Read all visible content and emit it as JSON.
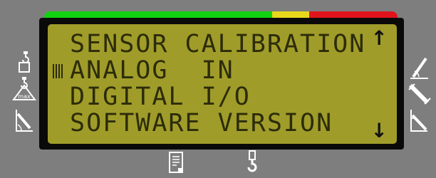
{
  "display": {
    "menu_items": [
      "SENSOR CALIBRATION",
      "ANALOG  IN",
      "DIGITAL I/O",
      "SOFTWARE VERSION"
    ],
    "selected_index": 1,
    "scroll_up_arrow": "↑",
    "scroll_down_arrow": "↓"
  },
  "left_icons": {
    "load_icon": "hook-load-icon",
    "max_load_icon": "max-load-icon",
    "max_load_label": "max",
    "boom_angle_icon": "boom-angle-icon"
  },
  "right_icons": {
    "boom_lower_icon": "boom-lower-icon",
    "boom_telescope_icon": "boom-telescope-icon",
    "boom_raise_icon": "boom-raise-icon"
  },
  "bottom_icons": {
    "document_icon": "document-icon",
    "hook_icon": "crane-hook-icon"
  },
  "colors": {
    "status_green": "#12d212",
    "status_yellow": "#e8d81c",
    "status_red": "#e0141c",
    "lcd_background": "#a09c2a",
    "panel_background": "#7e7e7e"
  }
}
